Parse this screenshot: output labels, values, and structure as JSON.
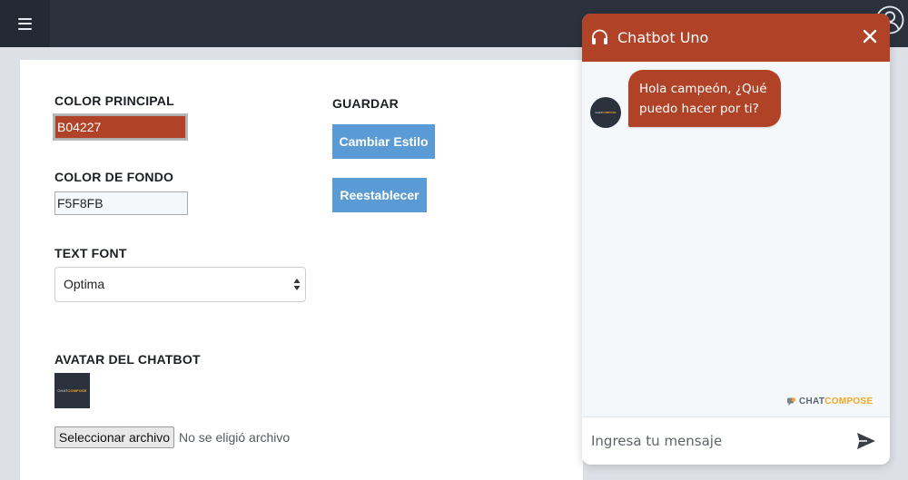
{
  "topbar": {
    "menu_icon": "hamburger-menu-icon",
    "user_icon": "user-account-icon"
  },
  "settings": {
    "primary_color": {
      "label": "COLOR PRINCIPAL",
      "value": "B04227"
    },
    "background_color": {
      "label": "COLOR DE FONDO",
      "value": "F5F8FB"
    },
    "text_font": {
      "label": "TEXT FONT",
      "selected": "Optima"
    },
    "avatar": {
      "label": "AVATAR DEL CHATBOT",
      "file_button": "Seleccionar archivo",
      "file_status": "No se eligió archivo"
    },
    "save": {
      "label": "GUARDAR",
      "change_style_button": "Cambiar Estilo",
      "reset_button": "Reestablecer"
    }
  },
  "chat": {
    "title": "Chatbot Uno",
    "header_icon": "headset-icon",
    "close_icon": "close-icon",
    "messages": [
      {
        "from": "bot",
        "text_line1": "Hola campeón, ¿Qué",
        "text_line2": "puedo hacer por ti?"
      }
    ],
    "branding": {
      "part1": "CHAT",
      "part2": "COMPOSE"
    },
    "composer": {
      "placeholder": "Ingresa tu mensaje",
      "send_icon": "send-icon"
    }
  },
  "colors": {
    "primary": "#B04227",
    "background": "#F5F8FB",
    "topbar": "#2B323D",
    "button": "#5B9BD5",
    "brand_accent": "#F5A623"
  }
}
